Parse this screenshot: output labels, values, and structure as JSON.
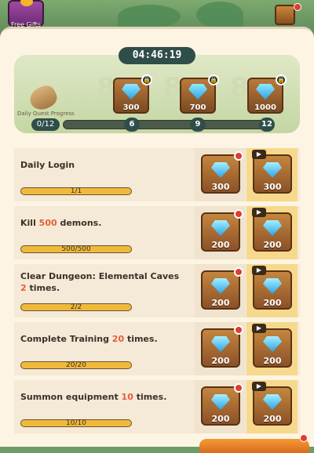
{
  "header": {
    "free_gifts_label": "Free Gifts",
    "timer": "04:46:19"
  },
  "progress": {
    "label": "Daily Quest Progress",
    "count": "0/12",
    "fill_fraction": 0.0,
    "milestones": [
      {
        "amount": "300",
        "threshold": "6"
      },
      {
        "amount": "700",
        "threshold": "9"
      },
      {
        "amount": "1000",
        "threshold": "12"
      }
    ]
  },
  "quests": [
    {
      "title_pre": "Daily Login",
      "title_hl": "",
      "title_post": "",
      "progress": "1/1",
      "reward": "300",
      "ad_reward": "300"
    },
    {
      "title_pre": "Kill ",
      "title_hl": "500",
      "title_post": " demons.",
      "progress": "500/500",
      "reward": "200",
      "ad_reward": "200"
    },
    {
      "title_pre": "Clear Dungeon: Elemental Caves ",
      "title_hl": "2",
      "title_post": " times.",
      "progress": "2/2",
      "reward": "200",
      "ad_reward": "200"
    },
    {
      "title_pre": "Complete Training ",
      "title_hl": "20",
      "title_post": " times.",
      "progress": "20/20",
      "reward": "200",
      "ad_reward": "200"
    },
    {
      "title_pre": "Summon equipment ",
      "title_hl": "10",
      "title_post": " times.",
      "progress": "10/10",
      "reward": "200",
      "ad_reward": "200"
    }
  ],
  "colors": {
    "accent": "#e35e3c",
    "dark_pill": "#2f4e4a",
    "bar_fill": "#f0b93a"
  }
}
